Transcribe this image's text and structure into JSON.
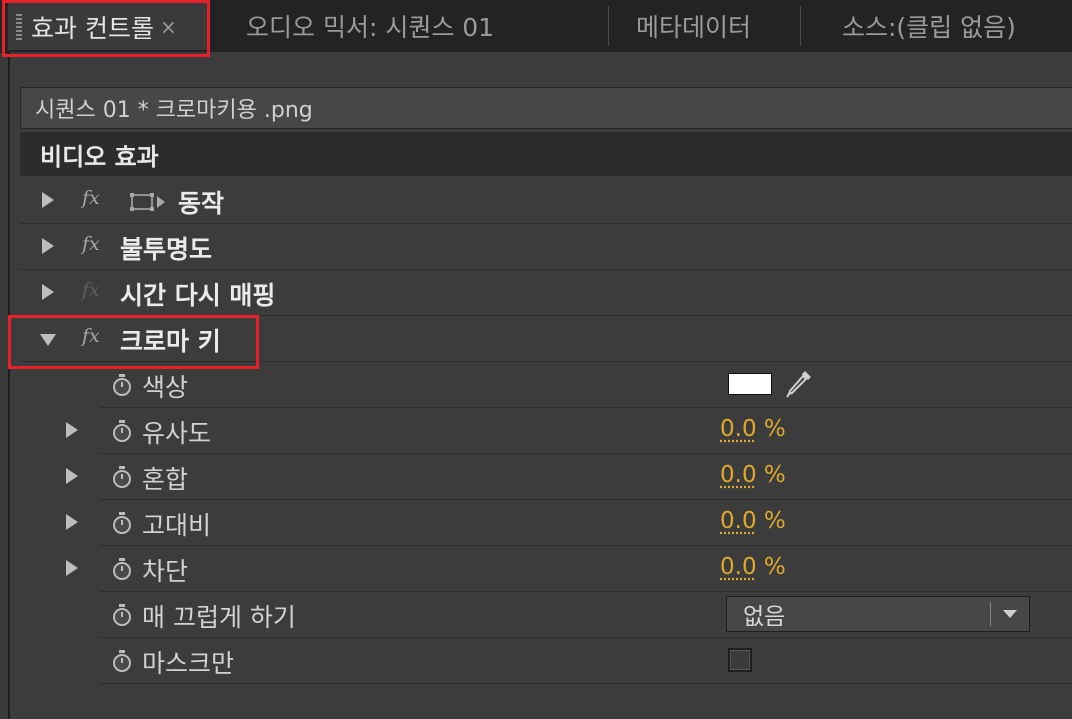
{
  "tabs": [
    {
      "label": "효과 컨트롤",
      "active": true,
      "close": "×"
    },
    {
      "label": "오디오 믹서: 시퀀스 01"
    },
    {
      "label": "메타데이터"
    },
    {
      "label": "소스:(클립 없음)"
    }
  ],
  "clip": {
    "label": "시퀀스 01 * 크로마키용 .png"
  },
  "section": {
    "title": "비디오 효과"
  },
  "effects": [
    {
      "label": "동작",
      "expanded": false,
      "fx_enabled": true
    },
    {
      "label": "불투명도",
      "expanded": false,
      "fx_enabled": true
    },
    {
      "label": "시간 다시 매핑",
      "expanded": false,
      "fx_enabled": false
    },
    {
      "label": "크로마 키",
      "expanded": true,
      "fx_enabled": true
    }
  ],
  "params": {
    "color": {
      "label": "색상",
      "value": "#FFFFFF"
    },
    "similarity": {
      "label": "유사도",
      "value": "0.0",
      "unit": "%"
    },
    "blend": {
      "label": "혼합",
      "value": "0.0",
      "unit": "%"
    },
    "contrast": {
      "label": "고대비",
      "value": "0.0",
      "unit": "%"
    },
    "cutoff": {
      "label": "차단",
      "value": "0.0",
      "unit": "%"
    },
    "smoothing": {
      "label": "매 끄럽게 하기",
      "value": "없음"
    },
    "mask_only": {
      "label": "마스크만",
      "checked": false
    }
  },
  "colors": {
    "value_accent": "#E0A92C",
    "highlight": "#E8202A"
  }
}
